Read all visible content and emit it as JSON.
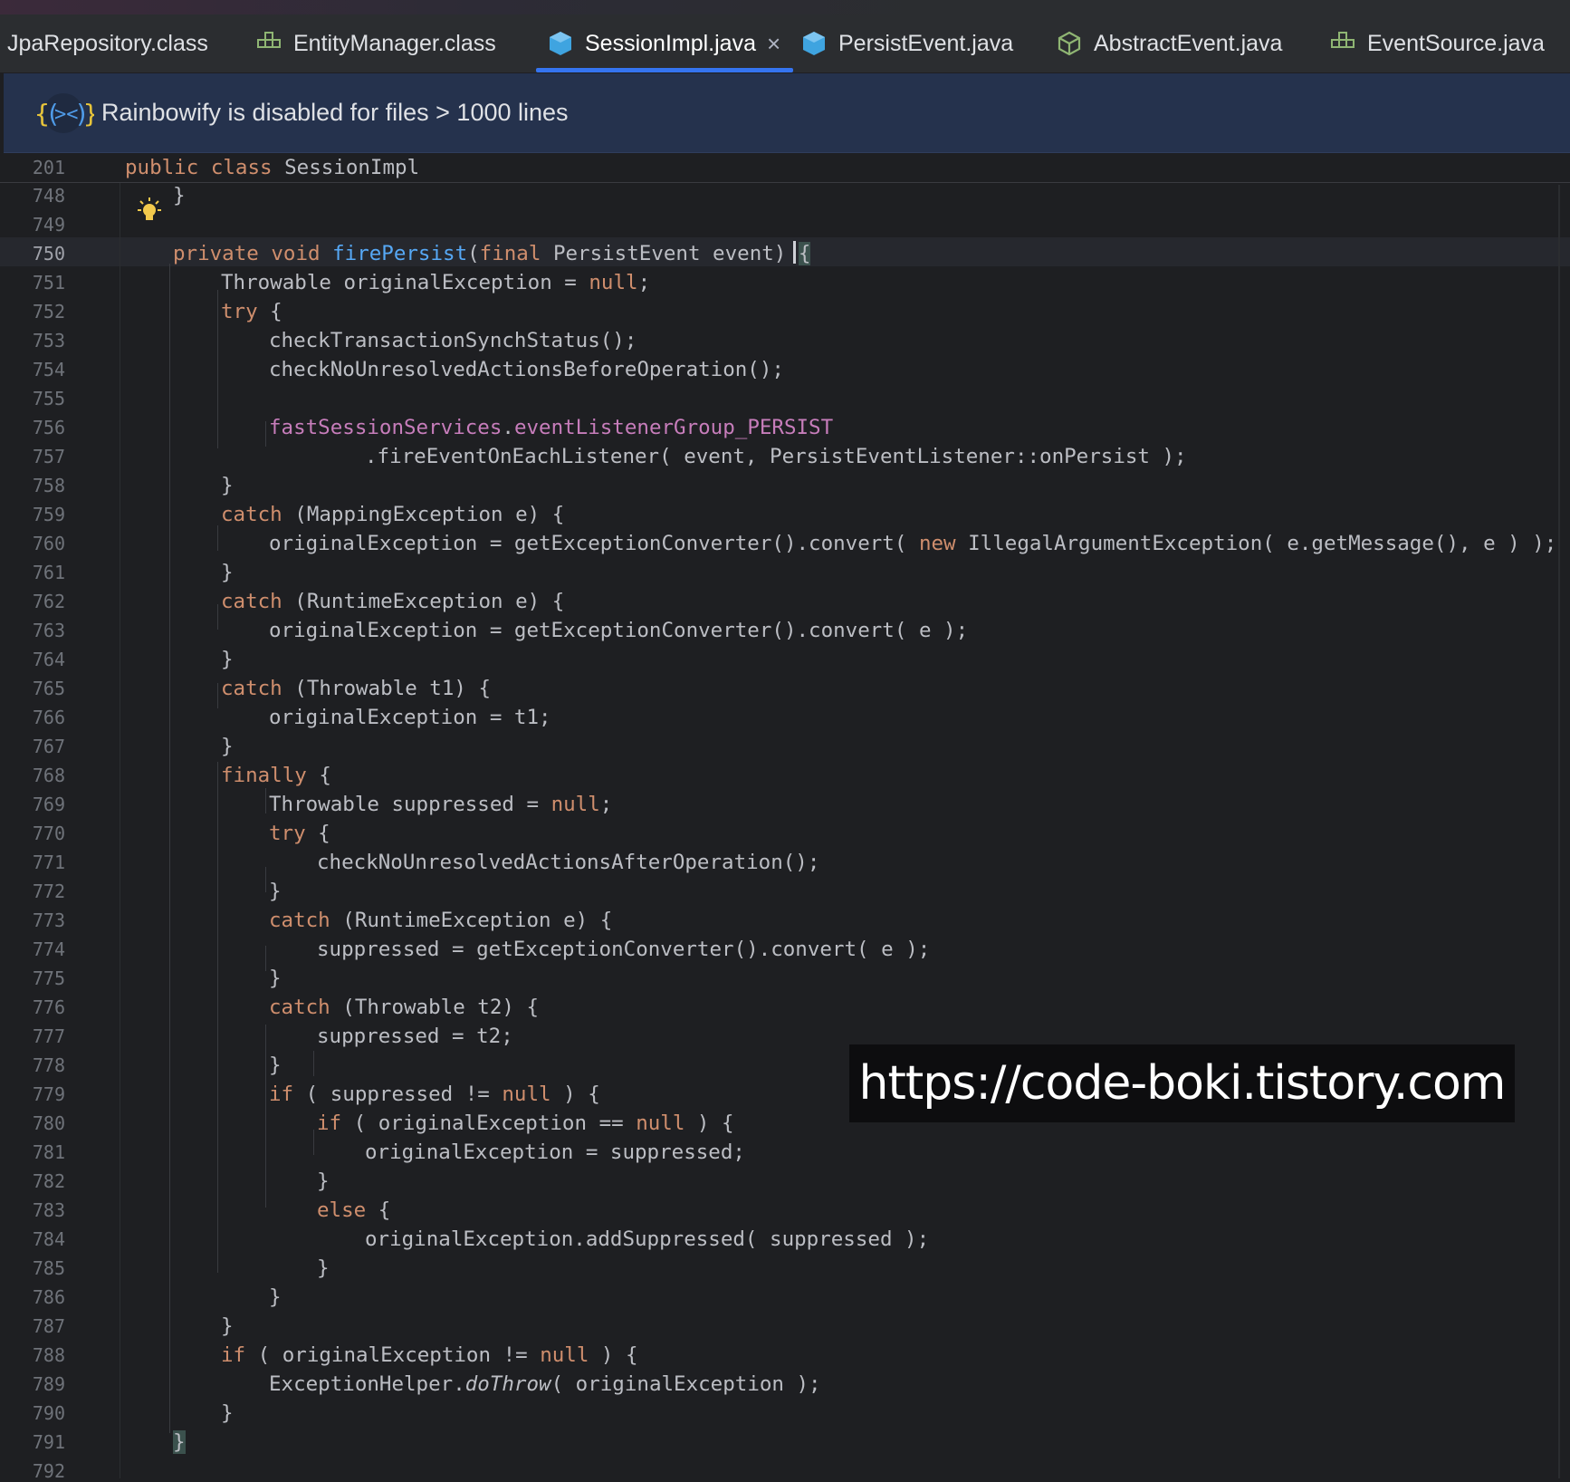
{
  "tabs": [
    {
      "label": "JpaRepository.class",
      "icon": "interface-icon"
    },
    {
      "label": "EntityManager.class",
      "icon": "interface-icon"
    },
    {
      "label": "SessionImpl.java",
      "icon": "class-icon",
      "active": true,
      "close": "×"
    },
    {
      "label": "PersistEvent.java",
      "icon": "class-icon"
    },
    {
      "label": "AbstractEvent.java",
      "icon": "abstract-class-icon"
    },
    {
      "label": "EventSource.java",
      "icon": "interface-icon"
    }
  ],
  "banner": {
    "text": "Rainbowify is disabled for files > 1000 lines",
    "icon": "rainbowify-icon",
    "icon_glyph": "{(><)}"
  },
  "sticky": {
    "line_number": "201",
    "keyword1": "public",
    "keyword2": "class",
    "class_name": "SessionImpl"
  },
  "line_numbers": [
    "748",
    "749",
    "750",
    "751",
    "752",
    "753",
    "754",
    "755",
    "756",
    "757",
    "758",
    "759",
    "760",
    "761",
    "762",
    "763",
    "764",
    "765",
    "766",
    "767",
    "768",
    "769",
    "770",
    "771",
    "772",
    "773",
    "774",
    "775",
    "776",
    "777",
    "778",
    "779",
    "780",
    "781",
    "782",
    "783",
    "784",
    "785",
    "786",
    "787",
    "788",
    "789",
    "790",
    "791",
    "792"
  ],
  "code": {
    "l748": "}",
    "l750": {
      "kw1": "private",
      "kw2": "void",
      "fn": "firePersist",
      "p1": "(",
      "kw3": "final",
      "rest": " PersistEvent event) ",
      "brace": "{"
    },
    "l751": {
      "a": "Throwable originalException = ",
      "kw": "null",
      "b": ";"
    },
    "l752": {
      "kw": "try",
      "b": " {"
    },
    "l753": "checkTransactionSynchStatus();",
    "l754": "checkNoUnresolvedActionsBeforeOperation();",
    "l756": {
      "f1": "fastSessionServices",
      "dot": ".",
      "f2": "eventListenerGroup_PERSIST"
    },
    "l757": ".fireEventOnEachListener( event, PersistEventListener::onPersist );",
    "l758": "}",
    "l759": {
      "kw": "catch",
      "b": " (MappingException e) {"
    },
    "l760": {
      "a": "originalException = getExceptionConverter().convert( ",
      "kw": "new",
      "b": " IllegalArgumentException( e.getMessage(), e ) );"
    },
    "l761": "}",
    "l762": {
      "kw": "catch",
      "b": " (RuntimeException e) {"
    },
    "l763": "originalException = getExceptionConverter().convert( e );",
    "l764": "}",
    "l765": {
      "kw": "catch",
      "b": " (Throwable t1) {"
    },
    "l766": "originalException = t1;",
    "l767": "}",
    "l768": {
      "kw": "finally",
      "b": " {"
    },
    "l769": {
      "a": "Throwable suppressed = ",
      "kw": "null",
      "b": ";"
    },
    "l770": {
      "kw": "try",
      "b": " {"
    },
    "l771": "checkNoUnresolvedActionsAfterOperation();",
    "l772": "}",
    "l773": {
      "kw": "catch",
      "b": " (RuntimeException e) {"
    },
    "l774": "suppressed = getExceptionConverter().convert( e );",
    "l775": "}",
    "l776": {
      "kw": "catch",
      "b": " (Throwable t2) {"
    },
    "l777": "suppressed = t2;",
    "l778": "}",
    "l779": {
      "kw": "if",
      "a": " ( suppressed != ",
      "kw2": "null",
      "b": " ) {"
    },
    "l780": {
      "kw": "if",
      "a": " ( originalException == ",
      "kw2": "null",
      "b": " ) {"
    },
    "l781": "originalException = suppressed;",
    "l782": "}",
    "l783": {
      "kw": "else",
      "b": " {"
    },
    "l784": "originalException.addSuppressed( suppressed );",
    "l785": "}",
    "l786": "}",
    "l787": "}",
    "l788": {
      "kw": "if",
      "a": " ( originalException != ",
      "kw2": "null",
      "b": " ) {"
    },
    "l789": {
      "a": "ExceptionHelper.",
      "it": "doThrow",
      "b": "( originalException );"
    },
    "l790": "}",
    "l791": "}"
  },
  "watermark": "https://code-boki.tistory.com",
  "colors": {
    "keyword": "#cf8e6d",
    "function": "#56a8f5",
    "field": "#c77dbb",
    "text": "#bcbec4",
    "accent": "#3574f0",
    "banner_bg": "#25324d"
  }
}
